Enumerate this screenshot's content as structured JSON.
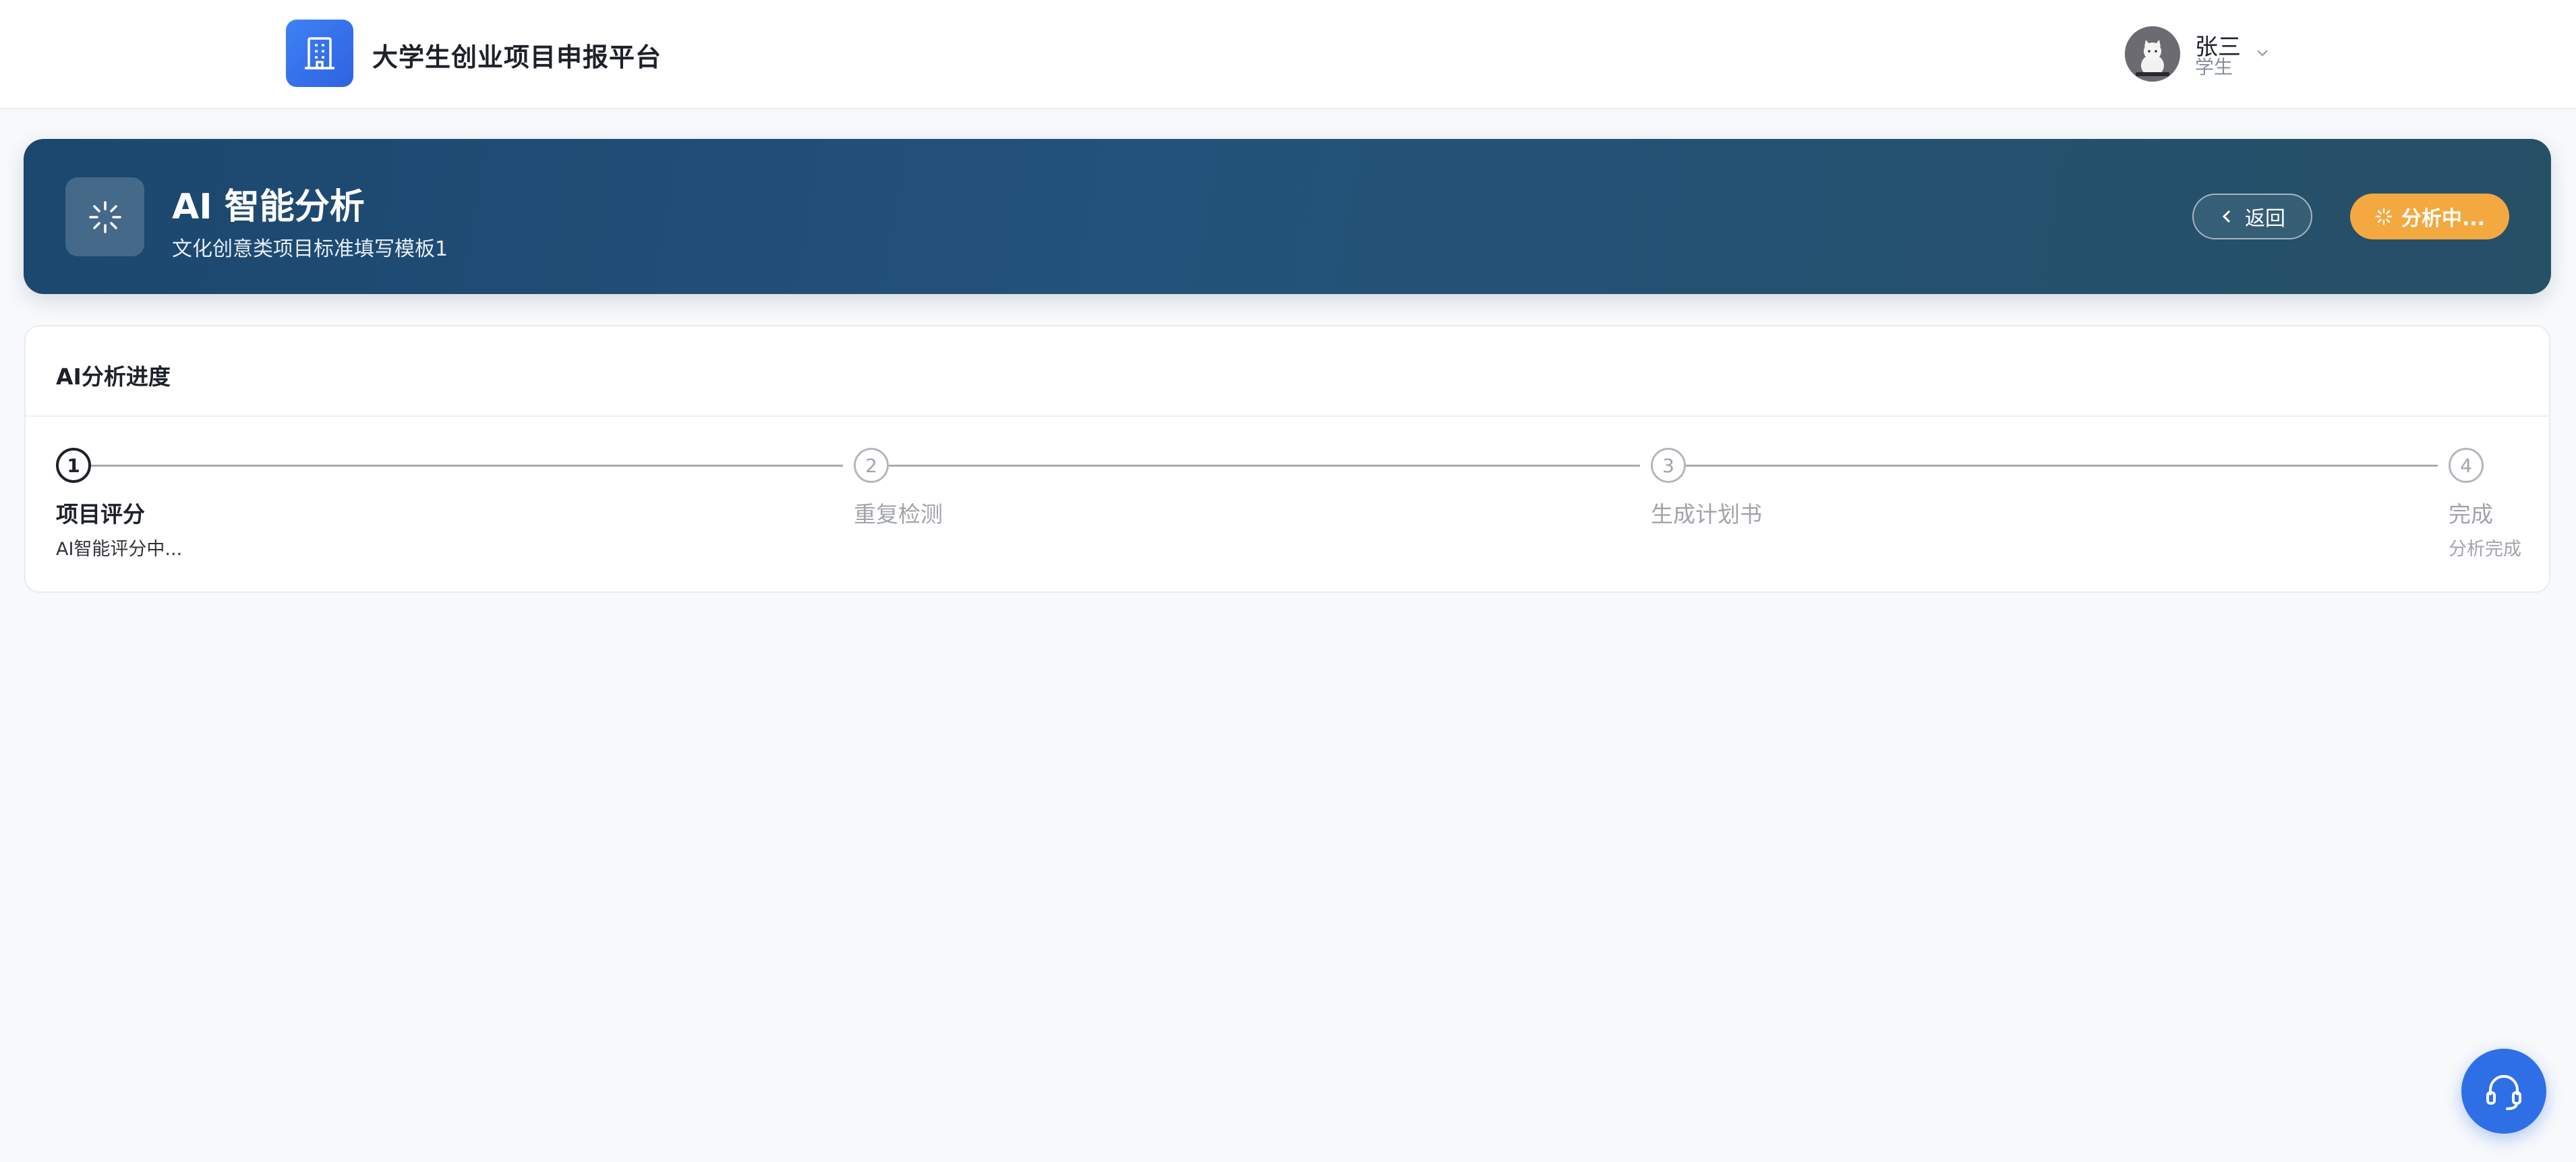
{
  "header": {
    "app_title": "大学生创业项目申报平台",
    "user_name": "张三",
    "user_role": "学生"
  },
  "banner": {
    "title": "AI 智能分析",
    "subtitle": "文化创意类项目标准填写模板1",
    "back_label": "返回",
    "status_label": "分析中..."
  },
  "progress": {
    "title": "AI分析进度",
    "current_step": 1,
    "steps": [
      {
        "number": "1",
        "label": "项目评分",
        "desc": "AI智能评分中...",
        "state": "active"
      },
      {
        "number": "2",
        "label": "重复检测",
        "desc": "",
        "state": "wait"
      },
      {
        "number": "3",
        "label": "生成计划书",
        "desc": "",
        "state": "wait"
      },
      {
        "number": "4",
        "label": "完成",
        "desc": "分析完成",
        "state": "wait"
      }
    ]
  },
  "colors": {
    "brand_blue": "#2f6fe6",
    "banner_start": "#1c476f",
    "banner_end": "#265066",
    "warning_orange": "#f3a93f"
  },
  "icons": {
    "logo": "building-icon",
    "banner": "loading-spinner-icon",
    "back": "chevron-left-icon",
    "status": "loading-spinner-icon",
    "user_menu": "chevron-down-icon",
    "fab": "headset-icon"
  }
}
